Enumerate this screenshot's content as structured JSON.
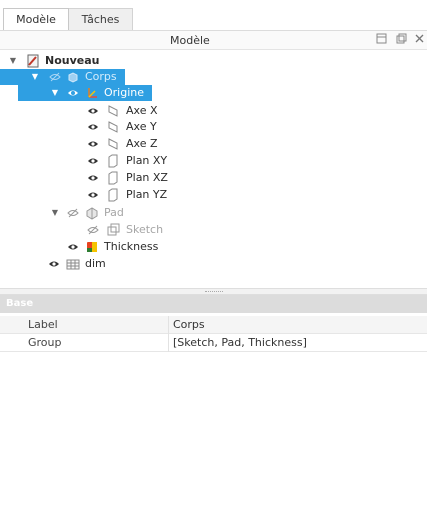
{
  "tabs": [
    {
      "label": "Modèle",
      "active": true
    },
    {
      "label": "Tâches",
      "active": false
    }
  ],
  "pane_header": {
    "title": "Modèle",
    "buttons": [
      "restore-icon",
      "float-icon",
      "close-icon"
    ]
  },
  "tree": {
    "items": [
      {
        "label": "Nouveau",
        "icon": "document-icon",
        "expanded": true,
        "bold": true
      },
      {
        "label": "Corps",
        "icon": "body-icon",
        "expanded": true,
        "selected": true,
        "dimmed": true
      },
      {
        "label": "Origine",
        "icon": "origin-icon",
        "expanded": true,
        "selected": true
      },
      {
        "label": "Axe X",
        "icon": "axis-icon"
      },
      {
        "label": "Axe Y",
        "icon": "axis-icon"
      },
      {
        "label": "Axe Z",
        "icon": "axis-icon"
      },
      {
        "label": "Plan XY",
        "icon": "plane-icon"
      },
      {
        "label": "Plan XZ",
        "icon": "plane-icon"
      },
      {
        "label": "Plan YZ",
        "icon": "plane-icon"
      },
      {
        "label": "Pad",
        "icon": "pad-icon",
        "expanded": true,
        "dimmed": true,
        "visible": false
      },
      {
        "label": "Sketch",
        "icon": "sketch-icon",
        "dimmed": true,
        "visible": false
      },
      {
        "label": "Thickness",
        "icon": "thickness-icon"
      },
      {
        "label": "dim",
        "icon": "spreadsheet-icon"
      }
    ]
  },
  "properties": {
    "group": "Base",
    "rows": [
      {
        "name": "Label",
        "value": "Corps"
      },
      {
        "name": "Group",
        "value": "[Sketch, Pad, Thickness]"
      }
    ]
  },
  "colors": {
    "selection": "#2f9fe2",
    "thickness_icon": "#e8421f"
  }
}
